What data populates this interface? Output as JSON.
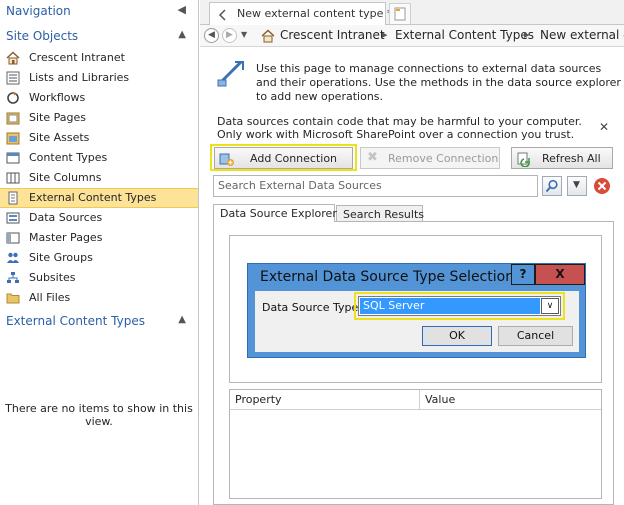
{
  "nav": {
    "title": "Navigation",
    "section1_title": "Site Objects",
    "items": [
      {
        "label": "Crescent Intranet",
        "icon": "home-icon"
      },
      {
        "label": "Lists and Libraries",
        "icon": "list-icon"
      },
      {
        "label": "Workflows",
        "icon": "workflow-icon"
      },
      {
        "label": "Site Pages",
        "icon": "pages-icon"
      },
      {
        "label": "Site Assets",
        "icon": "assets-icon"
      },
      {
        "label": "Content Types",
        "icon": "content-types-icon"
      },
      {
        "label": "Site Columns",
        "icon": "columns-icon"
      },
      {
        "label": "External Content Types",
        "icon": "external-content-types-icon"
      },
      {
        "label": "Data Sources",
        "icon": "data-sources-icon"
      },
      {
        "label": "Master Pages",
        "icon": "master-pages-icon"
      },
      {
        "label": "Site Groups",
        "icon": "groups-icon"
      },
      {
        "label": "Subsites",
        "icon": "subsites-icon"
      },
      {
        "label": "All Files",
        "icon": "folder-icon"
      }
    ],
    "selected_index": 7,
    "section2_title": "External Content Types",
    "empty_message": "There are no items to show in this view."
  },
  "tabs": {
    "doc_tab_label": "New external content type *"
  },
  "breadcrumb": {
    "items": [
      "Crescent Intranet",
      "External Content Types",
      "New external co"
    ]
  },
  "intro_text": "Use this page to manage connections to external data sources and their operations. Use the methods in the data source explorer to add new operations.",
  "warning_text": "Data sources contain code that may be harmful to your computer. Only work with Microsoft SharePoint over a connection you trust.",
  "toolbar": {
    "add_connection": "Add Connection",
    "remove_connection": "Remove Connection",
    "refresh_all": "Refresh All"
  },
  "search": {
    "placeholder": "Search External Data Sources"
  },
  "panel_tabs": [
    "Data Source Explorer",
    "Search Results"
  ],
  "dialog": {
    "title": "External Data Source Type Selection",
    "help": "?",
    "close": "X",
    "field_label": "Data Source Type",
    "field_value": "SQL Server",
    "ok": "OK",
    "cancel": "Cancel"
  },
  "grid": {
    "columns": [
      "Property",
      "Value"
    ]
  },
  "colors": {
    "accent": "#2a5fa6",
    "selected_bg": "#fde398",
    "highlight": "#ece21c",
    "dialog_blue": "#5294d6",
    "close_red": "#c75050"
  }
}
